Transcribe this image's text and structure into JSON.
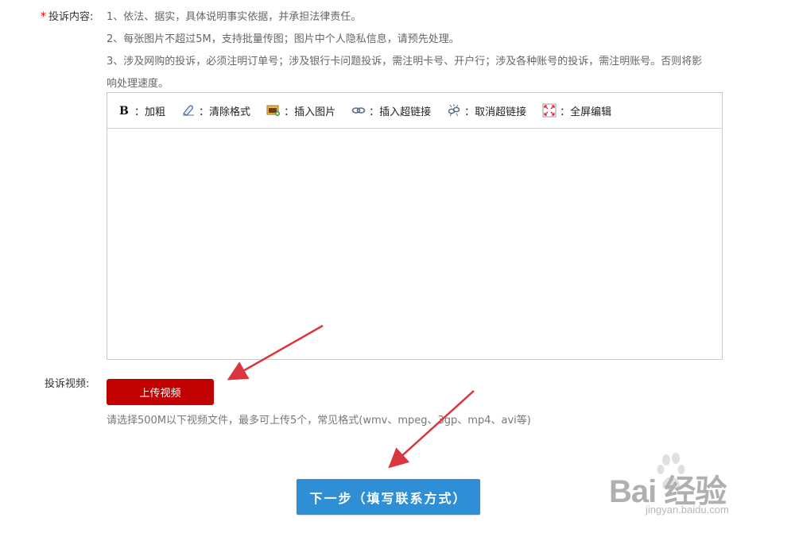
{
  "form": {
    "content_label": "投诉内容:",
    "required_mark": "*",
    "notes": [
      "1、依法、据实，具体说明事实依据，并承担法律责任。",
      "2、每张图片不超过5M，支持批量传图；图片中个人隐私信息，请预先处理。",
      "3、涉及网购的投诉，必须注明订单号；涉及银行卡问题投诉，需注明卡号、开户行；涉及各种账号的投诉，需注明账号。否则将影",
      "响处理速度。"
    ]
  },
  "editor": {
    "toolbar": [
      {
        "icon": "bold-icon",
        "label": "加粗"
      },
      {
        "icon": "eraser-icon",
        "label": "清除格式"
      },
      {
        "icon": "image-icon",
        "label": "插入图片"
      },
      {
        "icon": "link-icon",
        "label": "插入超链接"
      },
      {
        "icon": "unlink-icon",
        "label": "取消超链接"
      },
      {
        "icon": "fullscreen-icon",
        "label": "全屏编辑"
      }
    ],
    "separator": "："
  },
  "video": {
    "label": "投诉视频:",
    "upload_button": "上传视频",
    "hint": "请选择500M以下视频文件，最多可上传5个，常见格式(wmv、mpeg、3gp、mp4、avi等)"
  },
  "next_button": "下一步（填写联系方式）",
  "watermark": {
    "brand": "Bai  经验",
    "url": "jingyan.baidu.com"
  },
  "colors": {
    "upload_button": "#c10000",
    "next_button": "#2e8fd6",
    "annotation_arrow": "#d9363e",
    "required_mark": "#e00000"
  }
}
